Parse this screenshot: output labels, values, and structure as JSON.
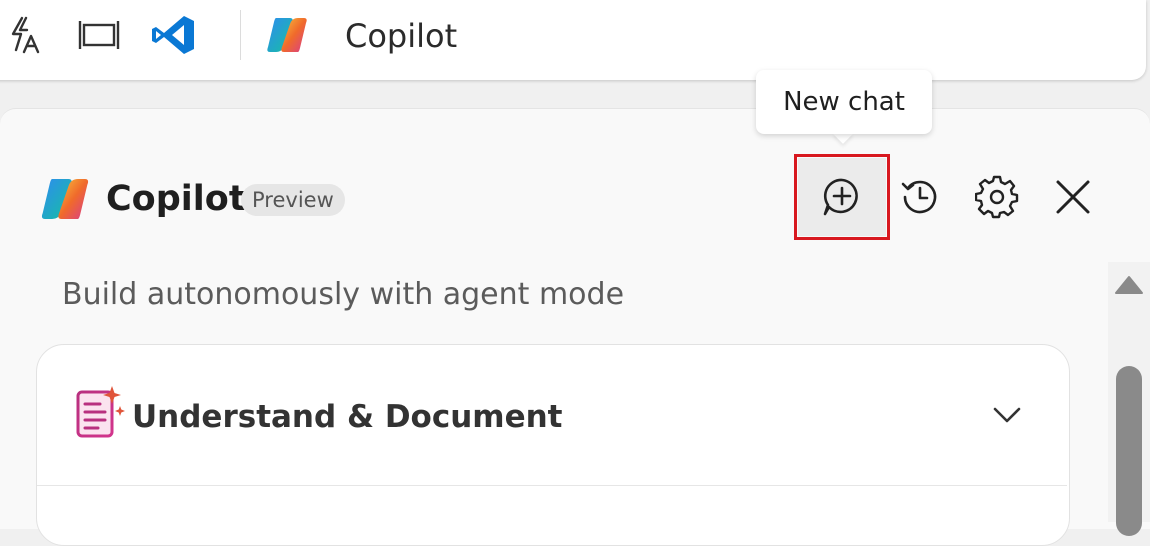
{
  "taskbar": {
    "icons": [
      "text-actions-icon",
      "window-frame-icon",
      "vscode-icon"
    ],
    "app_icon": "copilot-logo-icon",
    "app_title": "Copilot"
  },
  "tooltip": {
    "text": "New chat"
  },
  "header": {
    "title": "Copilot",
    "badge": "Preview",
    "buttons": [
      "new-chat-icon",
      "history-icon",
      "gear-icon",
      "close-icon"
    ]
  },
  "main": {
    "subtitle": "Build autonomously with agent mode",
    "card": {
      "icon": "document-sparkle-icon",
      "title": "Understand & Document",
      "chevron": "chevron-down-icon"
    }
  },
  "colors": {
    "highlight": "#d8181f",
    "vscode_blue": "#0a78d4"
  }
}
